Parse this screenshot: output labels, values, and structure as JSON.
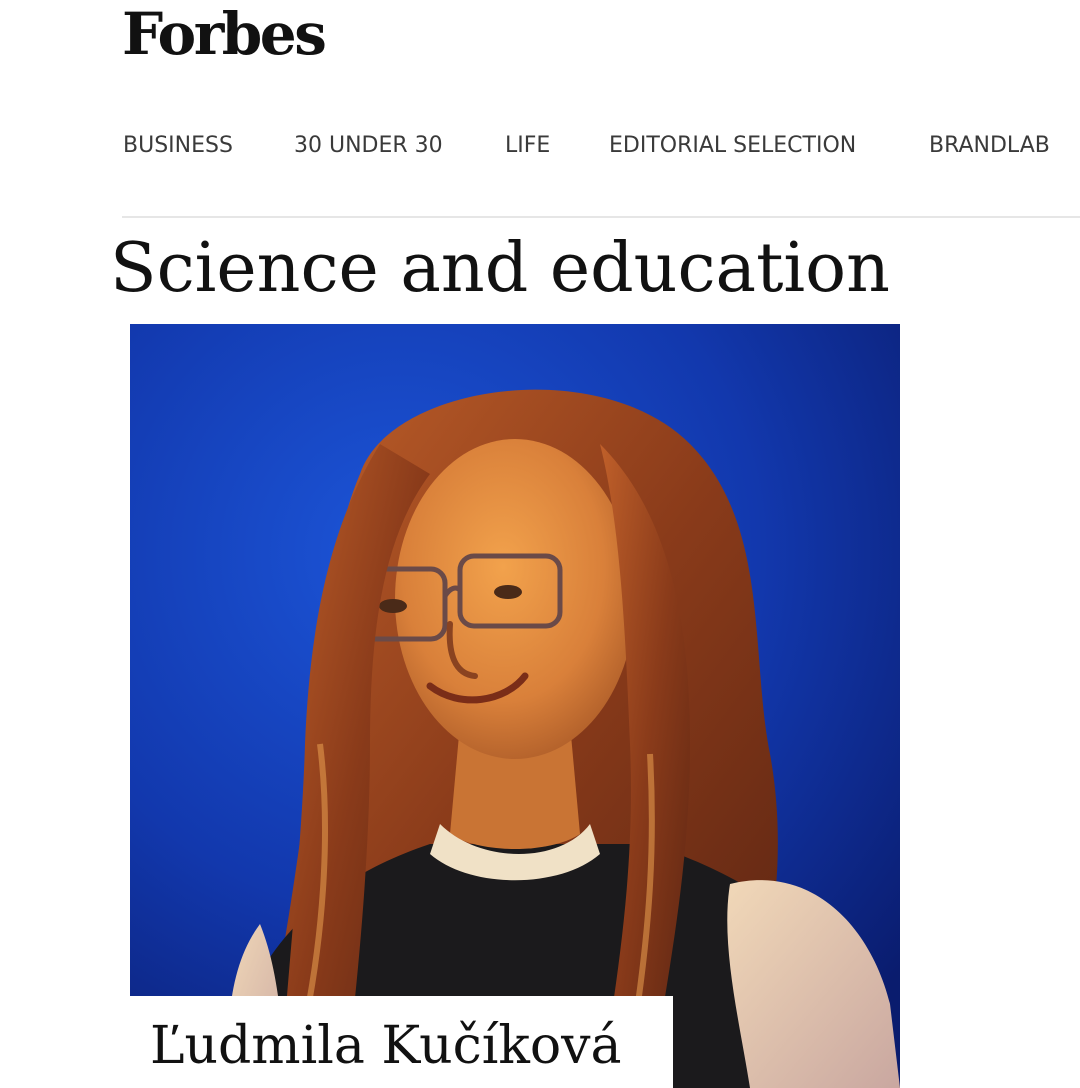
{
  "header": {
    "logo_text": "Forbes"
  },
  "nav": {
    "items": [
      {
        "label": "BUSINESS"
      },
      {
        "label": "30 UNDER 30"
      },
      {
        "label": "LIFE"
      },
      {
        "label": "EDITORIAL SELECTION"
      },
      {
        "label": "BRANDLAB"
      }
    ]
  },
  "main": {
    "title": "Science and education",
    "feature": {
      "person_name": "Ľudmila Kučíková"
    }
  },
  "colors": {
    "background": "#ffffff",
    "text": "#111111",
    "nav_text": "#3a3a3a",
    "divider": "#e6e6e6",
    "photo_backdrop": "#0f33a6",
    "photo_warm_light": "#e0903a"
  }
}
